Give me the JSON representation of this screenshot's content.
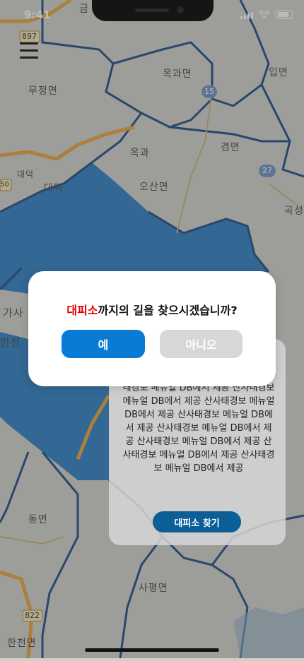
{
  "status_bar": {
    "time": "9:41"
  },
  "map": {
    "labels": {
      "geum": "금",
      "mujeong": "무정면",
      "okgwa_myeon": "옥과면",
      "ip_myeon": "입면",
      "okgwa": "옥과",
      "gyeom_myeon": "겸면",
      "daedeok_small": "대덕",
      "daedeok": "대덕",
      "osan": "오산면",
      "gokseong": "곡성",
      "gasa": "가사",
      "hancheon_line": "한천",
      "dong_myeon": "동면",
      "sapyeong": "사평면",
      "hancheon_myeon": "한천면"
    },
    "road_shields": {
      "r897": "897",
      "r50": "50",
      "r15": "15",
      "r27": "27",
      "r822": "822"
    },
    "colors": {
      "flood_zone": "#2e7fc4",
      "boundary": "#1f4e86",
      "road": "#e8a33c"
    }
  },
  "info_card": {
    "description": "태경보 메뉴얼 DB에서 제공 산사태경보 메뉴얼 DB에서 제공 산사태경보 메뉴얼 DB에서 제공 산사태경보 메뉴얼 DB에서 제공 산사태경보 메뉴얼 DB에서 제공 산사태경보 메뉴얼 DB에서 제공 산사태경보 메뉴얼 DB에서 제공 산사태경보 메뉴얼 DB에서 제공",
    "find_button": "대피소 찾기"
  },
  "dialog": {
    "title_highlight": "대피소",
    "title_rest": "까지의 길을 찾으시겠습니까?",
    "yes_label": "예",
    "no_label": "아니오",
    "highlight_color": "#e00000",
    "yes_color": "#0a7bd4"
  }
}
